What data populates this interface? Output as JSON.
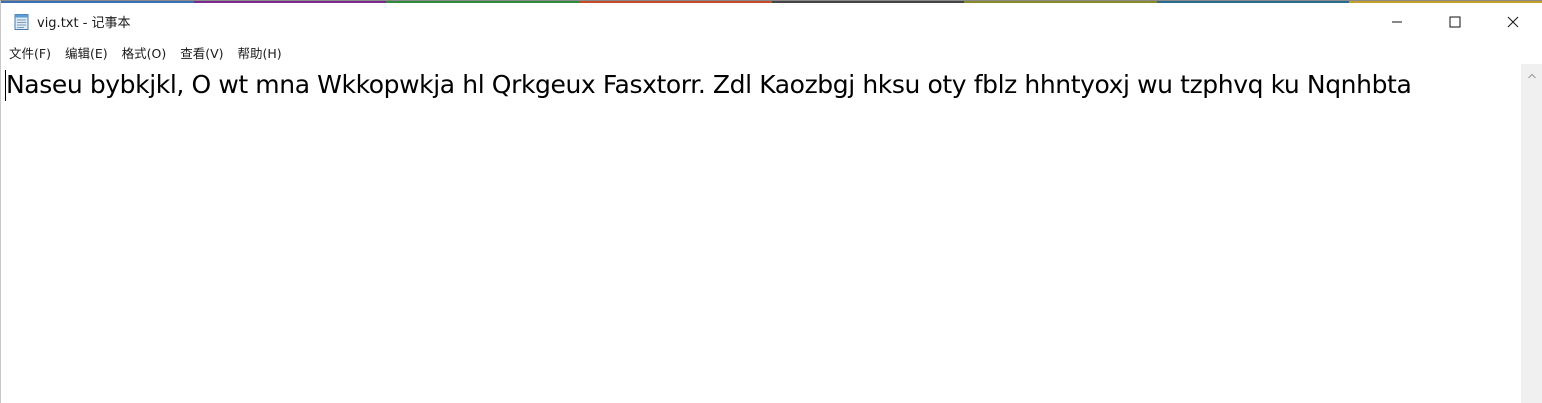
{
  "window": {
    "title": "vig.txt - 记事本",
    "icon": "notepad-icon",
    "caption_buttons": {
      "minimize": "minimize-icon",
      "maximize": "maximize-icon",
      "close": "close-icon"
    }
  },
  "menu": {
    "items": [
      {
        "label": "文件(F)"
      },
      {
        "label": "编辑(E)"
      },
      {
        "label": "格式(O)"
      },
      {
        "label": "查看(V)"
      },
      {
        "label": "帮助(H)"
      }
    ]
  },
  "editor": {
    "content": "Naseu bybkjkl, O wt mna Wkkopwkja hl Qrkgeux Fasxtorr. Zdl Kaozbgj hksu oty fblz hhntyoxj wu tzphvq ku Nqnhbta"
  },
  "scrollbar": {
    "up_arrow": "chevron-up-icon"
  },
  "colors": {
    "background": "#ffffff",
    "text": "#000000",
    "scrollbar_track": "#f0f0f0",
    "scroll_arrow": "#a0a0a0"
  }
}
